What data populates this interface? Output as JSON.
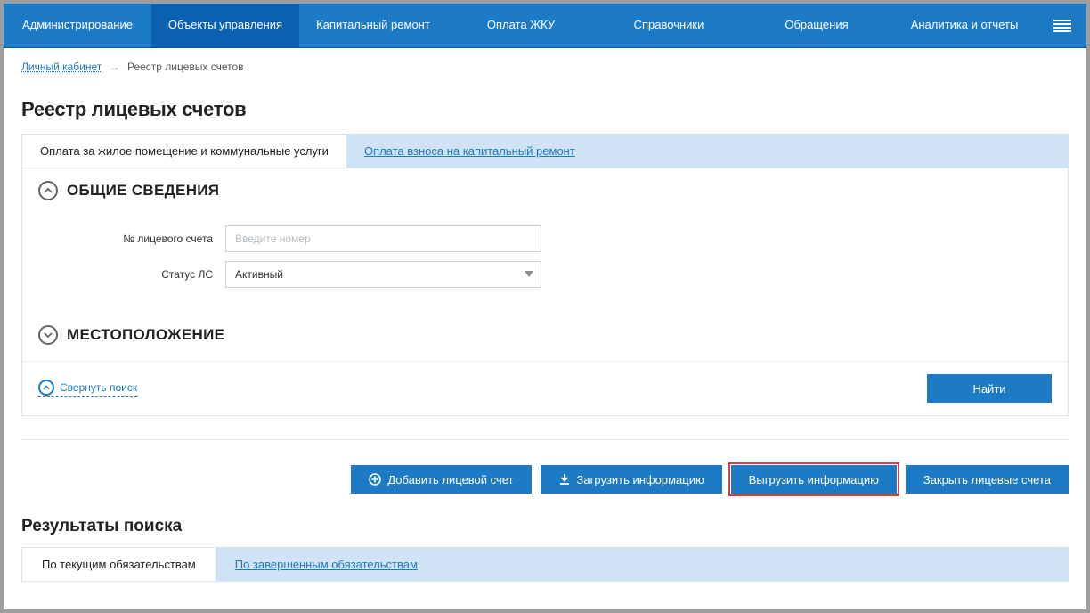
{
  "nav": {
    "items": [
      "Администрирование",
      "Объекты управления",
      "Капитальный ремонт",
      "Оплата ЖКУ",
      "Справочники",
      "Обращения",
      "Аналитика и отчеты"
    ],
    "activeIndex": 1
  },
  "breadcrumbs": {
    "home": "Личный кабинет",
    "arrow": "→",
    "current": "Реестр лицевых счетов"
  },
  "page_title": "Реестр лицевых счетов",
  "main_tabs": {
    "tab1": "Оплата за жилое помещение и коммунальные услуги",
    "tab2": "Оплата взноса на капитальный ремонт"
  },
  "sections": {
    "general": "ОБЩИЕ СВЕДЕНИЯ",
    "location": "МЕСТОПОЛОЖЕНИЕ"
  },
  "form": {
    "account_label": "№ лицевого счета",
    "account_placeholder": "Введите номер",
    "account_value": "",
    "status_label": "Статус ЛС",
    "status_value": "Активный"
  },
  "collapse_link": "Свернуть поиск",
  "find_btn": "Найти",
  "actions": {
    "add": "Добавить лицевой счет",
    "upload": "Загрузить информацию",
    "download": "Выгрузить информацию",
    "close": "Закрыть лицевые счета"
  },
  "results_title": "Результаты поиска",
  "results_tabs": {
    "tab1": "По текущим обязательствам",
    "tab2": "По завершенным обязательствам"
  }
}
